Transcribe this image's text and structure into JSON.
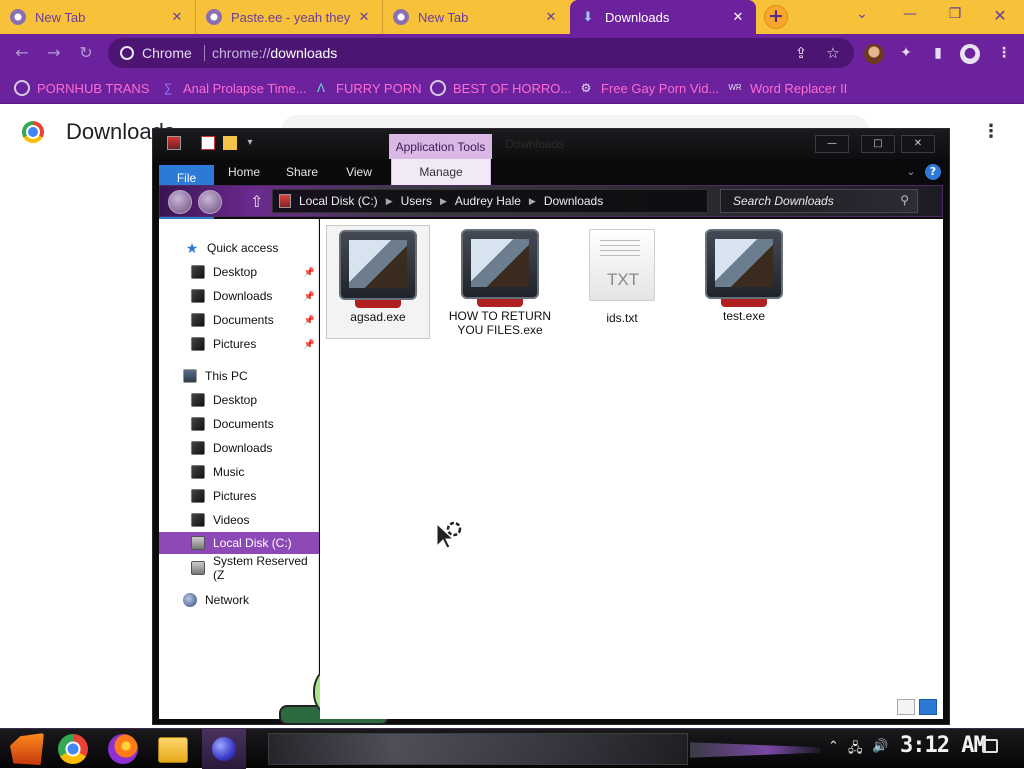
{
  "chrome": {
    "tabs": [
      {
        "label": "New Tab",
        "icon": "chrome-favicon",
        "active": false
      },
      {
        "label": "Paste.ee - yeah they",
        "icon": "chrome-favicon",
        "active": false
      },
      {
        "label": "New Tab",
        "icon": "chrome-favicon",
        "active": false
      },
      {
        "label": "Downloads",
        "icon": "download-icon",
        "active": true
      }
    ],
    "new_tab_label": "+",
    "omnibox": {
      "site_label": "Chrome",
      "url_prefix": "chrome://",
      "url_host": "downloads"
    },
    "bookmarks": [
      {
        "label": "PORNHUB TRANS",
        "icon": "globe-icon"
      },
      {
        "label": "Anal Prolapse Time...",
        "icon": "bookmark-icon"
      },
      {
        "label": "FURRY PORN",
        "icon": "lambda-icon"
      },
      {
        "label": "BEST OF HORRO...",
        "icon": "globe-icon"
      },
      {
        "label": "Free Gay Porn Vid...",
        "icon": "gear-icon"
      },
      {
        "label": "Word Replacer II",
        "icon": "wr-icon"
      }
    ],
    "page_title": "Downloads"
  },
  "explorer": {
    "window_title": "Downloads",
    "context_tab_group": "Application Tools",
    "ribbon_tabs": [
      "File",
      "Home",
      "Share",
      "View",
      "Manage"
    ],
    "breadcrumbs": [
      "Local Disk (C:)",
      "Users",
      "Audrey Hale",
      "Downloads"
    ],
    "search_placeholder": "Search Downloads",
    "nav": {
      "quick_access": {
        "label": "Quick access",
        "items": [
          "Desktop",
          "Downloads",
          "Documents",
          "Pictures"
        ]
      },
      "this_pc": {
        "label": "This PC",
        "items": [
          "Desktop",
          "Documents",
          "Downloads",
          "Music",
          "Pictures",
          "Videos",
          "Local Disk (C:)",
          "System Reserved (Z"
        ]
      },
      "network": {
        "label": "Network"
      }
    },
    "files": [
      {
        "name": "agsad.exe",
        "type": "exe",
        "selected": true
      },
      {
        "name": "HOW TO RETURN YOU FILES.exe",
        "type": "exe",
        "selected": false
      },
      {
        "name": "ids.txt",
        "type": "txt",
        "ext_label": "TXT",
        "selected": false
      },
      {
        "name": "test.exe",
        "type": "exe",
        "selected": false
      }
    ]
  },
  "taskbar": {
    "clock": "3:12 AM",
    "tray_icons": [
      "chevron-up-icon",
      "network-icon",
      "volume-icon"
    ]
  },
  "colors": {
    "tab_strip": "#f7c23a",
    "chrome_accent": "#6d229d",
    "bookmark_text": "#ff6bd3",
    "explorer_bg": "#0c0c0e",
    "selection": "#8d49b6",
    "file_tab": "#2c79d6"
  }
}
